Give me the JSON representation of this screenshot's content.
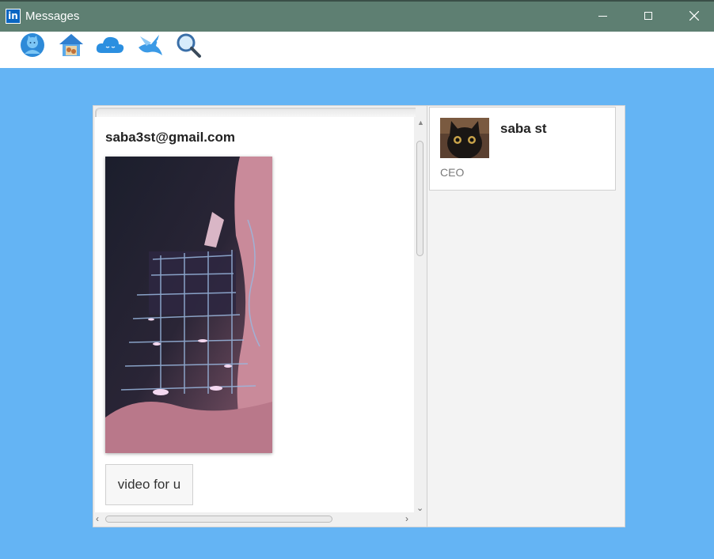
{
  "window": {
    "title": "Messages",
    "app_icon_text": "in",
    "controls": [
      "minimize",
      "maximize",
      "close"
    ]
  },
  "toolbar": {
    "icons": [
      "profile-icon",
      "home-icon",
      "cloud-icon",
      "bird-icon",
      "search-icon"
    ]
  },
  "chat": {
    "sender": "saba3st@gmail.com",
    "media": "video-thumbnail",
    "message_text": "video for u"
  },
  "contact": {
    "name": "saba st",
    "role": "CEO"
  },
  "colors": {
    "titlebar": "#5e7f72",
    "background": "#64b4f4",
    "linkedin_blue": "#0a66c2"
  }
}
